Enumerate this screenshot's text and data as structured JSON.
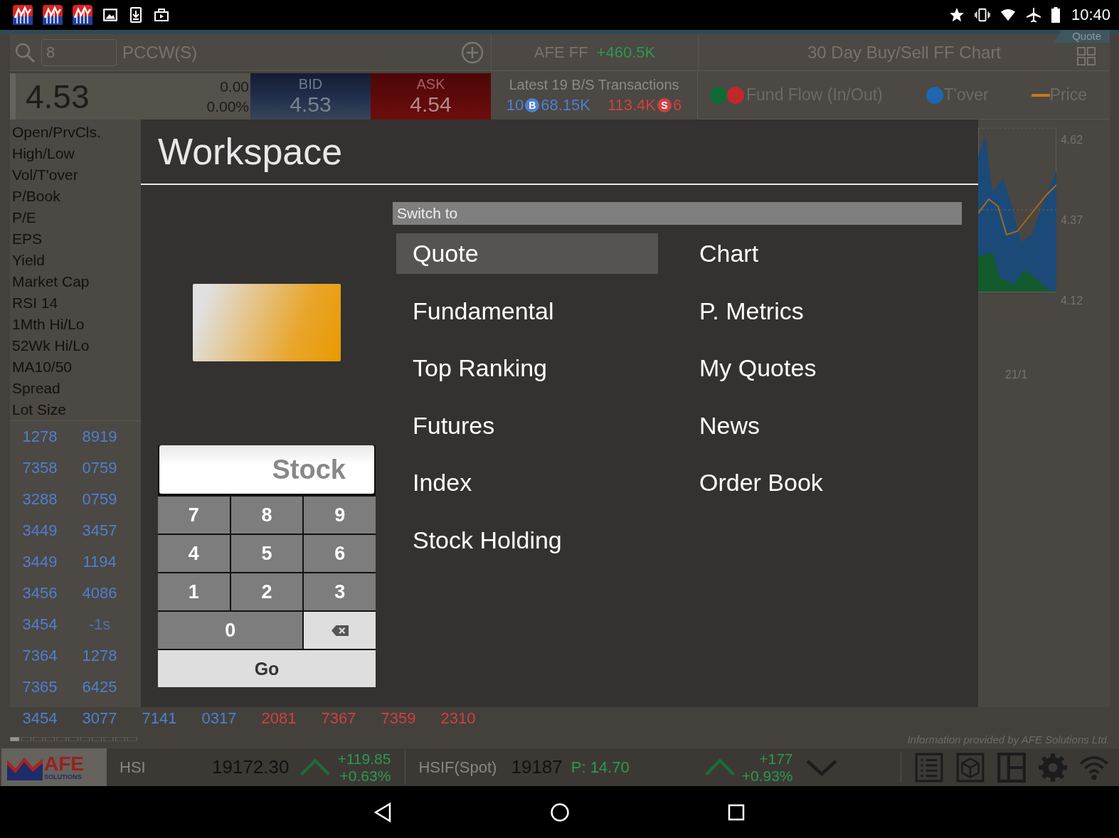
{
  "status_bar": {
    "time": "10:40"
  },
  "search": {
    "value": "8"
  },
  "stock_name": "PCCW(S)",
  "fund_flow": {
    "label": "AFE FF",
    "value": "+460.5K"
  },
  "chart_panel": {
    "title": "30 Day Buy/Sell FF Chart",
    "tab": "Quote",
    "legend": [
      {
        "label": "Fund Flow (In/Out)",
        "kind": "pair",
        "dots": [
          {
            "color": "#0f6b33"
          },
          {
            "color": "#c0282a"
          }
        ]
      },
      {
        "label": "T'over",
        "kind": "dot",
        "color": "#1f66b0"
      },
      {
        "label": "Price",
        "kind": "line",
        "color": "#c57a18"
      }
    ]
  },
  "quote": {
    "last": "4.53",
    "change": "0.00",
    "change_pct": "0.00%",
    "bid_label": "BID",
    "bid": "4.53",
    "ask_label": "ASK",
    "ask": "4.54"
  },
  "transactions": {
    "title": "Latest 19 B/S Transactions",
    "buy_count": "10",
    "buy_badge": "B",
    "buy_volume": "68.15K",
    "sell_volume": "113.4K",
    "sell_badge": "S",
    "sell_count": "6"
  },
  "stats": [
    "Open/PrvCls.",
    "High/Low",
    "Vol/T'over",
    "P/Book",
    "P/E",
    "EPS",
    "Yield",
    "Market Cap",
    "RSI 14",
    "1Mth Hi/Lo",
    "52Wk Hi/Lo",
    "MA10/50",
    "Spread",
    "Lot Size"
  ],
  "quote_grid": [
    [
      "1278",
      "8919"
    ],
    [
      "7358",
      "0759"
    ],
    [
      "3288",
      "0759"
    ],
    [
      "3449",
      "3457"
    ],
    [
      "3449",
      "1194"
    ],
    [
      "3456",
      "4086"
    ],
    [
      "3454",
      "-1s"
    ],
    [
      "7364",
      "1278"
    ],
    [
      "7365",
      "6425"
    ]
  ],
  "quote_grid_last_row": [
    "3454",
    "3077",
    "7141",
    "0317",
    "2081",
    "7367",
    "7359",
    "2310"
  ],
  "chart": {
    "y_labels": [
      "4.62",
      "4.37",
      "4.12"
    ],
    "x_labels": [
      "21/1"
    ]
  },
  "credit": "Information provided by AFE Solutions Ltd.",
  "ticker": {
    "logo": "AFE",
    "logo_sub": "SOLUTIONS",
    "items": [
      {
        "name": "HSI",
        "value": "19172.30",
        "rising": true,
        "change": "+119.85",
        "change_pct": "+0.63%"
      },
      {
        "name": "HSIF(Spot)",
        "value": "19187",
        "premium": "P: 14.70",
        "rising": true,
        "change": "+177",
        "change_pct": "+0.93%"
      }
    ]
  },
  "workspace": {
    "title": "Workspace",
    "section": "Switch to",
    "items": [
      {
        "label": "Quote",
        "selected": true
      },
      {
        "label": "Chart",
        "selected": false
      },
      {
        "label": "Fundamental",
        "selected": false
      },
      {
        "label": "P. Metrics",
        "selected": false
      },
      {
        "label": "Top Ranking",
        "selected": false
      },
      {
        "label": "My Quotes",
        "selected": false
      },
      {
        "label": "Futures",
        "selected": false
      },
      {
        "label": "News",
        "selected": false
      },
      {
        "label": "Index",
        "selected": false
      },
      {
        "label": "Order Book",
        "selected": false
      },
      {
        "label": "Stock Holding",
        "selected": false
      }
    ]
  },
  "keypad": {
    "field": "Stock",
    "keys": [
      "7",
      "8",
      "9",
      "4",
      "5",
      "6",
      "1",
      "2",
      "3",
      "0"
    ],
    "go": "Go"
  }
}
